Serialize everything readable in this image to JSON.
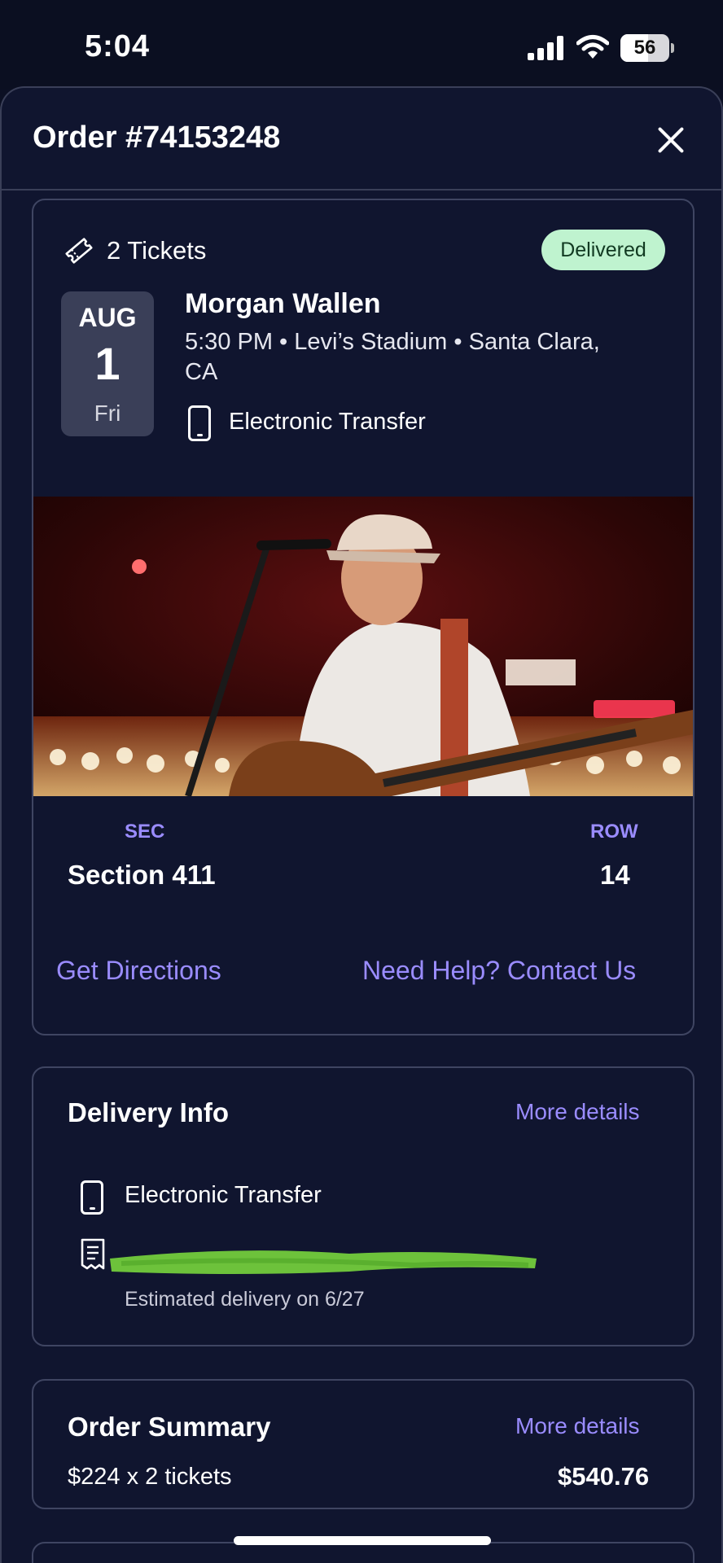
{
  "status_bar": {
    "time": "5:04",
    "battery": "56",
    "battery_level": 0.56
  },
  "header": {
    "title": "Order #74153248"
  },
  "ticket_card": {
    "ticket_count": "2 Tickets",
    "status_badge": "Delivered",
    "date": {
      "month": "AUG",
      "day": "1",
      "weekday": "Fri"
    },
    "artist": "Morgan Wallen",
    "details": "5:30 PM • Levi’s Stadium • Santa Clara, CA",
    "delivery_method": "Electronic Transfer",
    "seat": {
      "sec_label": "SEC",
      "sec_value": "Section 411",
      "row_label": "ROW",
      "row_value": "14"
    },
    "links": {
      "directions": "Get Directions",
      "help": "Need Help? Contact Us"
    }
  },
  "delivery_info": {
    "title": "Delivery Info",
    "more": "More details",
    "method": "Electronic Transfer",
    "estimated": "Estimated delivery on 6/27"
  },
  "order_summary": {
    "title": "Order Summary",
    "more": "More details",
    "line": "$224 x 2 tickets",
    "total": "$540.76"
  },
  "colors": {
    "accent": "#9a8cff",
    "background": "#10152f",
    "badge": "#bff3cf",
    "redaction": "#6dc23b"
  }
}
